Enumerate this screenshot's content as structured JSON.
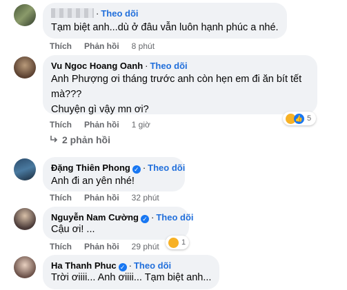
{
  "colors": {
    "bubble": "#f0f2f5",
    "follow": "#216fdb",
    "meta": "#65676b",
    "verified": "#1877f2"
  },
  "action_labels": {
    "like": "Thích",
    "reply": "Phản hồi"
  },
  "comments": [
    {
      "name": "",
      "name_hidden": true,
      "follow": "Theo dõi",
      "lines": [
        "Tạm biệt anh...dù ở đâu vẫn luôn hạnh phúc a nhé."
      ],
      "time": "8 phút"
    },
    {
      "name": "Vu Ngoc Hoang Oanh",
      "follow": "Theo dõi",
      "lines": [
        "Anh Phượng ơi tháng trước anh còn hẹn em đi ăn bít tết",
        "mà???",
        "Chuyện gì vậy mn ơi?"
      ],
      "time": "1 giờ",
      "reaction_count": "5",
      "reaction_icons": [
        "sad-emoji-icon",
        "like-icon"
      ]
    },
    {
      "name": "Đặng Thiên Phong",
      "verified": true,
      "follow": "Theo dõi",
      "lines": [
        "Anh đi an yên nhé!"
      ],
      "time": "32 phút"
    },
    {
      "name": "Nguyễn Nam Cường",
      "verified": true,
      "follow": "Theo dõi",
      "lines": [
        "Cậu ơi! ..."
      ],
      "time": "29 phút",
      "reaction_count": "1",
      "reaction_icons": [
        "sad-emoji-icon"
      ]
    },
    {
      "name": "Ha Thanh Phuc",
      "verified": true,
      "follow": "Theo dõi",
      "lines": [
        "Trời ơiiii... Anh ơiiii... Tạm biệt anh..."
      ]
    }
  ],
  "replies_link": {
    "label": "2 phản hồi",
    "icon": "reply-arrow-icon"
  }
}
